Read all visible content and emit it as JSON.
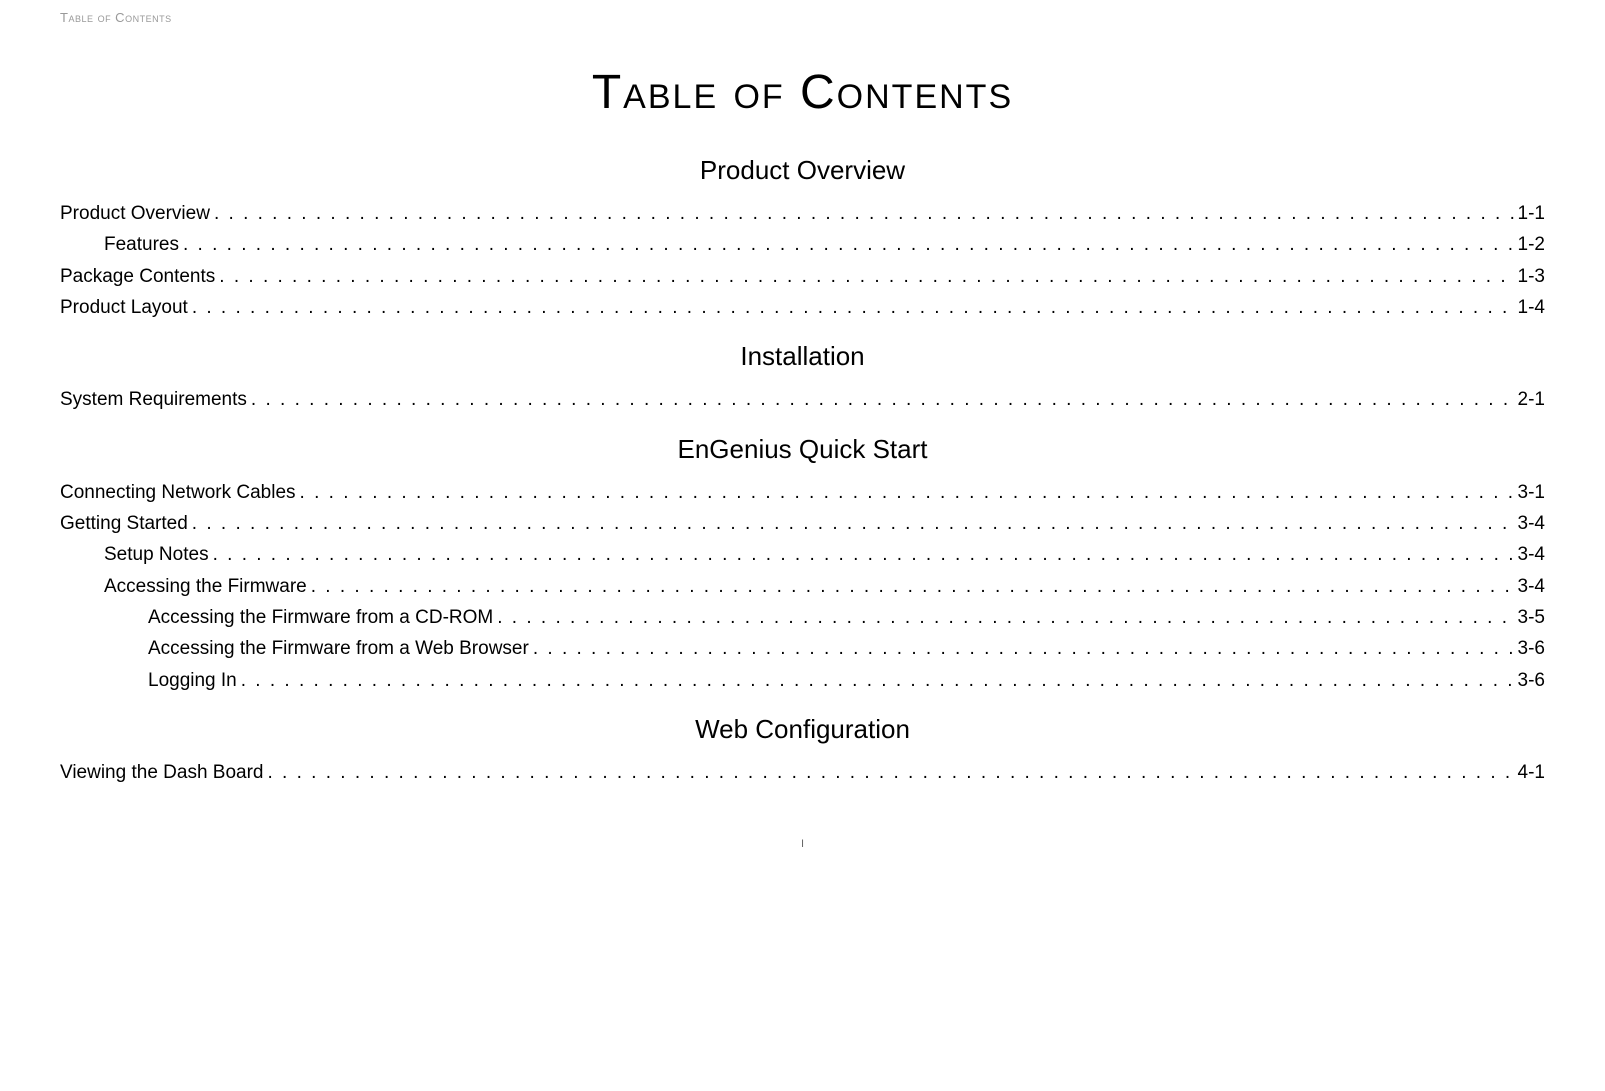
{
  "header_label": "Table of Contents",
  "main_title": "Table of Contents",
  "sections": [
    {
      "title": "Product Overview",
      "entries": [
        {
          "label": "Product Overview",
          "page": "1-1",
          "indent": 0
        },
        {
          "label": "Features",
          "page": "1-2",
          "indent": 1
        },
        {
          "label": "Package Contents",
          "page": "1-3",
          "indent": 0
        },
        {
          "label": "Product Layout",
          "page": "1-4",
          "indent": 0
        }
      ]
    },
    {
      "title": "Installation",
      "entries": [
        {
          "label": "System Requirements",
          "page": "2-1",
          "indent": 0
        }
      ]
    },
    {
      "title": "EnGenius Quick Start",
      "entries": [
        {
          "label": "Connecting Network Cables",
          "page": "3-1",
          "indent": 0
        },
        {
          "label": "Getting Started",
          "page": "3-4",
          "indent": 0
        },
        {
          "label": "Setup Notes",
          "page": "3-4",
          "indent": 1
        },
        {
          "label": "Accessing the Firmware",
          "page": "3-4",
          "indent": 1
        },
        {
          "label": "Accessing the Firmware from a CD-ROM",
          "page": "3-5",
          "indent": 2
        },
        {
          "label": "Accessing the Firmware from a Web Browser",
          "page": "3-6",
          "indent": 2
        },
        {
          "label": "Logging In",
          "page": "3-6",
          "indent": 2
        }
      ]
    },
    {
      "title": "Web Configuration",
      "entries": [
        {
          "label": "Viewing the Dash Board",
          "page": "4-1",
          "indent": 0
        }
      ]
    }
  ],
  "footer": "I"
}
